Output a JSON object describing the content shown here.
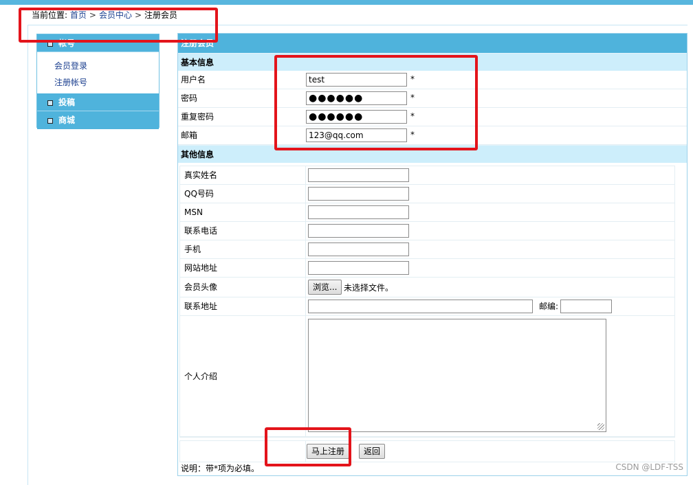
{
  "breadcrumb": {
    "prefix": "当前位置:",
    "items": [
      "首页",
      "会员中心",
      "注册会员"
    ],
    "separator": ">"
  },
  "sidebar": {
    "account_title": "帐号",
    "links": [
      "会员登录",
      "注册帐号"
    ],
    "submit_title": "投稿",
    "shop_title": "商城"
  },
  "panel": {
    "title": "注册会员",
    "basic_title": "基本信息",
    "basic": [
      {
        "label": "用户名",
        "value": "test",
        "required": "*"
      },
      {
        "label": "密码",
        "value": "●●●●●●",
        "required": "*"
      },
      {
        "label": "重复密码",
        "value": "●●●●●●",
        "required": "*"
      },
      {
        "label": "邮箱",
        "value": "123@qq.com",
        "required": "*"
      }
    ],
    "other_title": "其他信息",
    "other": [
      {
        "label": "真实姓名",
        "value": ""
      },
      {
        "label": "QQ号码",
        "value": ""
      },
      {
        "label": "MSN",
        "value": ""
      },
      {
        "label": "联系电话",
        "value": ""
      },
      {
        "label": "手机",
        "value": ""
      },
      {
        "label": "网站地址",
        "value": ""
      }
    ],
    "avatar_label": "会员头像",
    "browse_button": "浏览...",
    "no_file": "未选择文件。",
    "address_label": "联系地址",
    "zip_label": "邮编:",
    "intro_label": "个人介绍",
    "register_button": "马上注册",
    "back_button": "返回",
    "note": "说明：带*项为必填。"
  },
  "watermark": "CSDN @LDF-TSS",
  "colors": {
    "accent": "#4fb3dc",
    "section_bg": "#cdeefb",
    "highlight": "#e3141b",
    "link": "#1b3f8f"
  }
}
